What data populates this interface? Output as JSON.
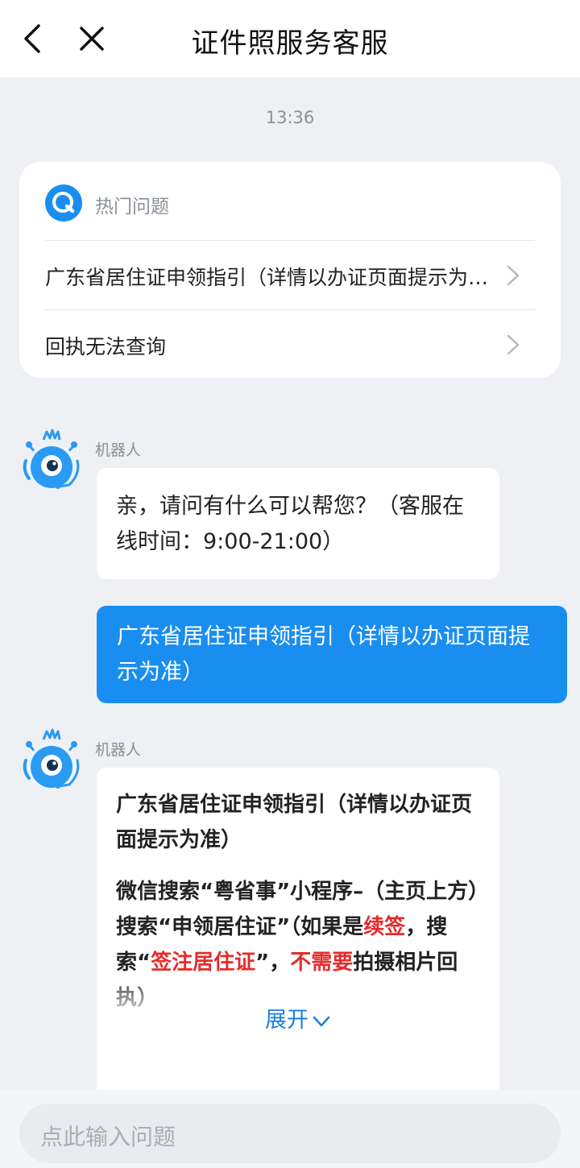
{
  "header": {
    "title": "证件照服务客服",
    "back_icon": "back-arrow-icon",
    "close_icon": "close-icon"
  },
  "chat": {
    "timestamp": "13:36"
  },
  "hot_questions": {
    "icon": "q-chat-icon",
    "title": "热门问题",
    "items": [
      {
        "label": "广东省居住证申领指引（详情以办证页面提示为准）"
      },
      {
        "label": "回执无法查询"
      }
    ]
  },
  "messages": [
    {
      "role": "bot",
      "sender": "机器人",
      "text": "亲，请问有什么可以帮您？（客服在线时间：9:00-21:00）"
    },
    {
      "role": "user",
      "text": "广东省居住证申领指引（详情以办证页面提示为准）"
    },
    {
      "role": "bot",
      "sender": "机器人",
      "heading": "广东省居住证申领指引（详情以办证页面提示为准）",
      "body": {
        "p1": "微信搜索“粤省事”小程序–（主页上方）搜索“申领居住证”（如果是",
        "red1": "续签",
        "p2": "，搜索“",
        "red2": "签注居住证",
        "p3": "”，",
        "red3": "不需要",
        "p4": "拍摄相片回执）"
      },
      "expand_label": "展开"
    }
  ],
  "input": {
    "placeholder": "点此输入问题"
  },
  "colors": {
    "accent": "#1a8ef0",
    "highlight_red": "#e52b2b",
    "background": "#eef0f4"
  }
}
